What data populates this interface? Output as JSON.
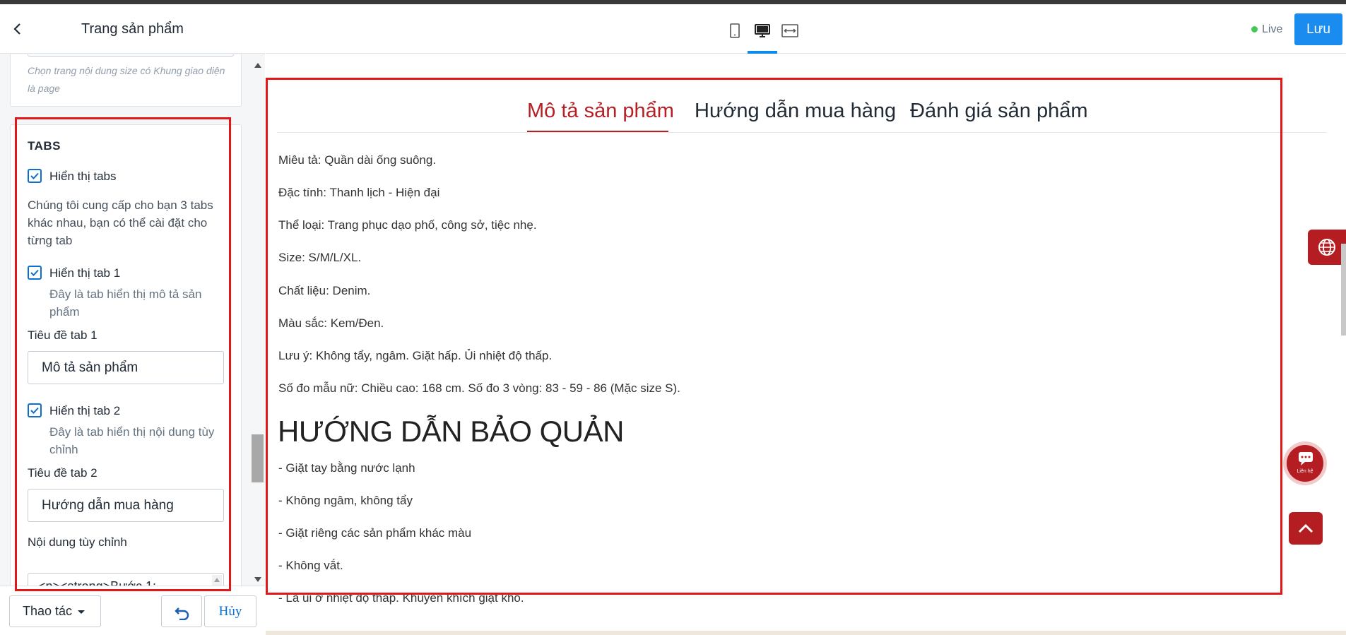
{
  "left_panel": {
    "title": "Trang sản phẩm",
    "top_card_hint": "Chọn trang nội dung size có Khung giao diện là page",
    "tabs_section": {
      "title": "TABS",
      "show_tabs_label": "Hiển thị tabs",
      "show_tabs_checked": true,
      "description": "Chúng tôi cung cấp cho bạn 3 tabs khác nhau, bạn có thể cài đặt cho từng tab",
      "tab1": {
        "show_label": "Hiển thị tab 1",
        "checked": true,
        "help": "Đây là tab hiển thị mô tả sản phẩm",
        "title_label": "Tiêu đề tab 1",
        "title_value": "Mô tả sản phẩm"
      },
      "tab2": {
        "show_label": "Hiển thị tab 2",
        "checked": true,
        "help": "Đây là tab hiển thị nội dung tùy chỉnh",
        "title_label": "Tiêu đề tab 2",
        "title_value": "Hướng dẫn mua hàng",
        "content_label": "Nội dung tùy chỉnh",
        "content_value": "<p><strong>Bước 1:"
      }
    },
    "footer": {
      "actions_label": "Thao tác",
      "cancel_label": "Hủy"
    }
  },
  "topbar": {
    "device_icons": [
      "mobile-icon",
      "desktop-icon",
      "fullwidth-icon"
    ],
    "active_device": "desktop",
    "live_label": "Live",
    "save_label": "Lưu"
  },
  "preview": {
    "tabs": [
      "Mô tả sản phẩm",
      "Hướng dẫn mua hàng",
      "Đánh giá sản phẩm"
    ],
    "active_tab": 0,
    "paragraphs": [
      "Miêu tả: Quần dài ống suông.",
      "Đặc tính: Thanh lịch - Hiện đại",
      "Thể loại: Trang phục dạo phố, công sở, tiệc nhẹ.",
      "Size: S/M/L/XL.",
      "Chất liệu: Denim.",
      "Màu sắc: Kem/Đen.",
      "Lưu ý: Không tẩy, ngâm. Giặt hấp. Ủi nhiệt độ thấp.",
      "Số đo mẫu nữ: Chiều cao: 168 cm. Số đo 3 vòng: 83 - 59 - 86 (Mặc size S)."
    ],
    "heading": "HƯỚNG DẪN BẢO QUẢN",
    "care_items": [
      "- Giặt tay bằng nước lạnh",
      "- Không ngâm, không tẩy",
      "- Giặt riêng các sản phẩm khác màu",
      "- Không vắt.",
      "- Là ủi ở nhiệt độ thấp. Khuyến khích giặt khô."
    ],
    "chat_widget_label": "Liên hệ"
  },
  "colors": {
    "accent_blue": "#1a8cf0",
    "brand_red": "#b41e23",
    "active_tab_red": "#b52025",
    "highlight_box": "#e21818",
    "live_green": "#44c658"
  }
}
